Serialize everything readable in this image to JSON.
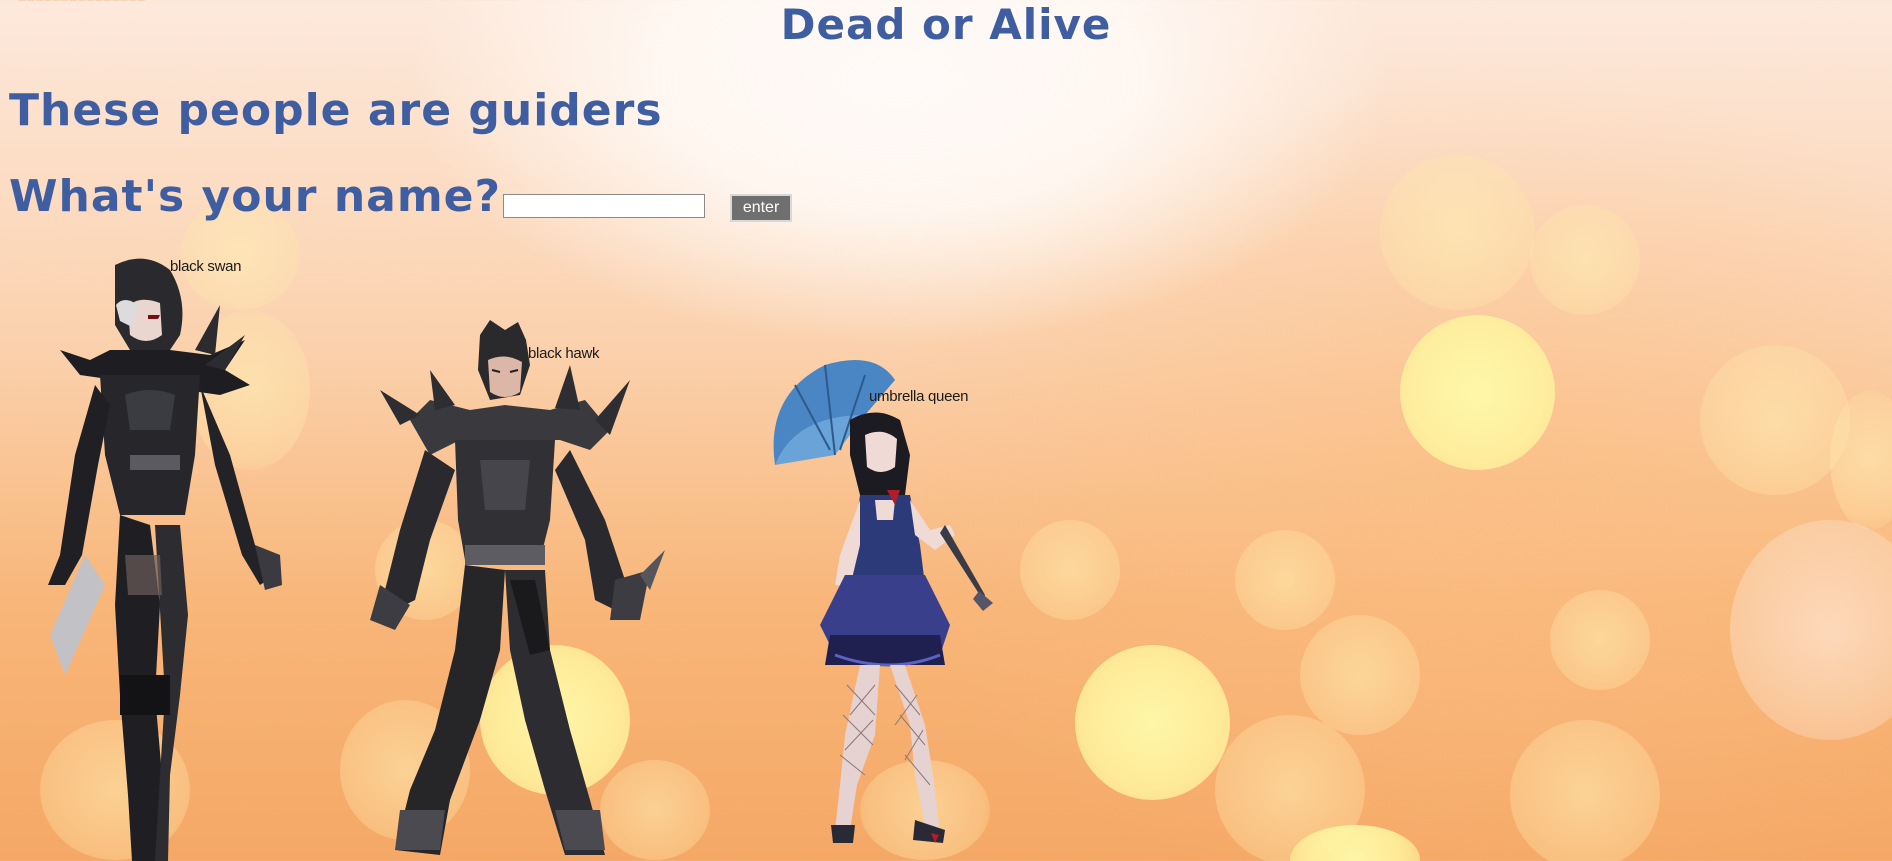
{
  "page": {
    "title": "Dead or Alive",
    "subheading": "These people are guiders",
    "name_prompt": "What's your name?",
    "name_input": {
      "value": "",
      "placeholder": ""
    },
    "enter_button": "enter"
  },
  "characters": [
    {
      "name": "black swan"
    },
    {
      "name": "black hawk"
    },
    {
      "name": "umbrella queen"
    }
  ],
  "colors": {
    "heading": "#3f5ea1",
    "button_bg": "#6f6f6f",
    "background_warm": "#f8b679"
  }
}
